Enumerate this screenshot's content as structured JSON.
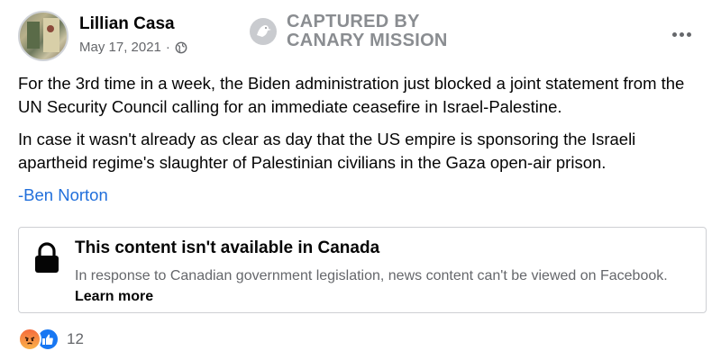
{
  "post": {
    "author": "Lillian Casa",
    "date": "May 17, 2021",
    "date_separator": "·",
    "privacy_icon": "globe-icon",
    "more_icon": "more-horizontal-icon"
  },
  "watermark": {
    "line1": "CAPTURED BY",
    "line2": "CANARY MISSION"
  },
  "content": {
    "paragraph1": "For the 3rd time in a week, the Biden administration just blocked a joint statement from the UN Security Council calling for an immediate ceasefire in Israel-Palestine.",
    "paragraph2": "In case it wasn't already as clear as day that the US empire is sponsoring the Israeli apartheid regime's slaughter of Palestinian civilians in the Gaza open-air prison.",
    "signature": "-Ben Norton"
  },
  "notice": {
    "icon": "lock-icon",
    "title": "This content isn't available in Canada",
    "text": "In response to Canadian government legislation, news content can't be viewed on Facebook.",
    "learn_more": "Learn more"
  },
  "reactions": {
    "icons": [
      "angry-reaction-icon",
      "like-reaction-icon"
    ],
    "count": "12"
  },
  "colors": {
    "link": "#216fdb",
    "secondary_text": "#65676b",
    "like_blue": "#1877f2",
    "watermark_gray": "#8a8d91"
  }
}
